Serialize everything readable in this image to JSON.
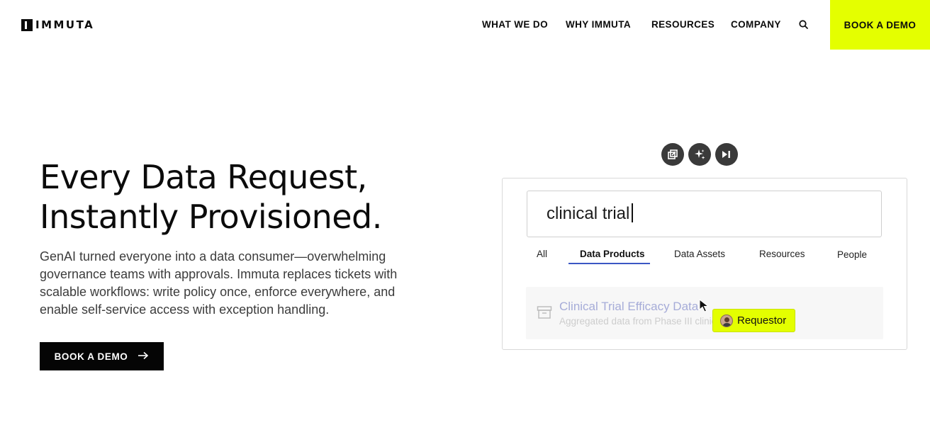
{
  "brand": {
    "name": "IMMUTA"
  },
  "nav": {
    "items": [
      {
        "label": "WHAT WE DO"
      },
      {
        "label": "WHY IMMUTA"
      },
      {
        "label": "RESOURCES"
      },
      {
        "label": "COMPANY"
      }
    ],
    "search_icon": "search-icon",
    "cta_label": "BOOK A DEMO",
    "cta_color": "#e4ff00"
  },
  "hero": {
    "headline_line1": "Every Data Request,",
    "headline_line2": "Instantly Provisioned.",
    "body": "GenAI turned everyone into a data consumer—overwhelming governance teams with approvals. Immuta replaces tickets with scalable workflows: write policy once, enforce everywhere, and enable self-service access with exception handling.",
    "cta_label": "BOOK A DEMO",
    "cta_icon": "arrow-right-icon"
  },
  "demo": {
    "controls": [
      {
        "icon": "open-external-icon"
      },
      {
        "icon": "sparkles-icon"
      },
      {
        "icon": "skip-forward-icon"
      }
    ],
    "search_value": "clinical trial",
    "tabs": [
      {
        "label": "All",
        "active": false
      },
      {
        "label": "Data Products",
        "active": true
      },
      {
        "label": "Data Assets",
        "active": false
      },
      {
        "label": "Resources",
        "active": false
      },
      {
        "label": "People",
        "active": false
      }
    ],
    "result": {
      "icon": "archive-box-icon",
      "title": "Clinical Trial Efficacy Data",
      "description": "Aggregated data from Phase III clinical trials for X"
    },
    "badge": {
      "label": "Requestor",
      "icon": "user-avatar"
    },
    "accent_color": "#3b57c4"
  }
}
